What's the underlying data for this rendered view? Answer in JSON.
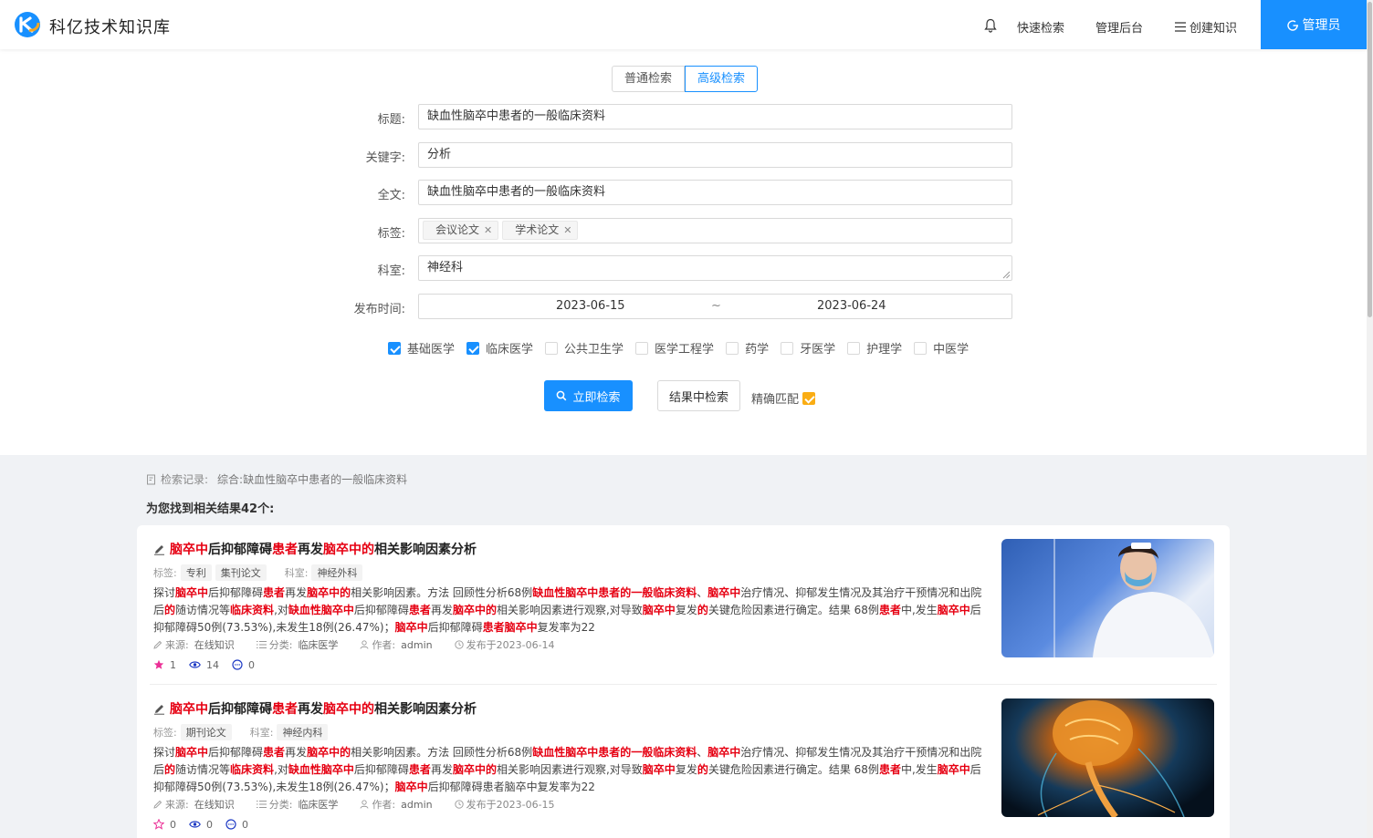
{
  "header": {
    "app_title": "科亿技术知识库",
    "nav": {
      "quick_search": "快速检索",
      "admin": "管理后台",
      "create": "创建知识"
    },
    "user": "管理员"
  },
  "search": {
    "tabs": [
      "普通检索",
      "高级检索"
    ],
    "active_tab": "高级检索",
    "fields": {
      "title_label": "标题:",
      "title_value": "缺血性脑卒中患者的一般临床资料",
      "keyword_label": "关键字:",
      "keyword_value": "分析",
      "fulltext_label": "全文:",
      "fulltext_value": "缺血性脑卒中患者的一般临床资料",
      "tags_label": "标签:",
      "tags": [
        "会议论文",
        "学术论文"
      ],
      "dept_label": "科室:",
      "dept_value": "神经科",
      "date_label": "发布时间:",
      "date_start": "2023-06-15",
      "date_sep": "~",
      "date_end": "2023-06-24"
    },
    "categories": [
      {
        "label": "基础医学",
        "checked": true
      },
      {
        "label": "临床医学",
        "checked": true
      },
      {
        "label": "公共卫生学",
        "checked": false
      },
      {
        "label": "医学工程学",
        "checked": false
      },
      {
        "label": "药学",
        "checked": false
      },
      {
        "label": "牙医学",
        "checked": false
      },
      {
        "label": "护理学",
        "checked": false
      },
      {
        "label": "中医学",
        "checked": false
      }
    ],
    "search_button": "立即检索",
    "in_results_button": "结果中检索",
    "exact_match": "精确匹配",
    "exact_checked": true
  },
  "history": {
    "label": "检索记录:",
    "value": "综合:缺血性脑卒中患者的一般临床资料"
  },
  "result_count": "为您找到相关结果42个:",
  "results": [
    {
      "tags_label": "标签:",
      "tags": [
        "专利",
        "集刊论文"
      ],
      "dept_label": "科室:",
      "dept": "神经外科",
      "source_label": "来源:",
      "source": "在线知识",
      "category_label": "分类:",
      "category": "临床医学",
      "author_label": "作者:",
      "author": "admin",
      "published": "发布于2023-06-14",
      "likes": "1",
      "views": "14",
      "comments": "0"
    },
    {
      "tags_label": "标签:",
      "tags": [
        "期刊论文"
      ],
      "dept_label": "科室:",
      "dept": "神经内科",
      "source_label": "来源:",
      "source": "在线知识",
      "category_label": "分类:",
      "category": "临床医学",
      "author_label": "作者:",
      "author": "admin",
      "published": "发布于2023-06-15",
      "likes": "0",
      "views": "0",
      "comments": "0"
    }
  ],
  "colors": {
    "primary": "#1890ff",
    "highlight": "#e60012",
    "exact_check": "#faad14",
    "star_filled": "#eb2f96"
  }
}
